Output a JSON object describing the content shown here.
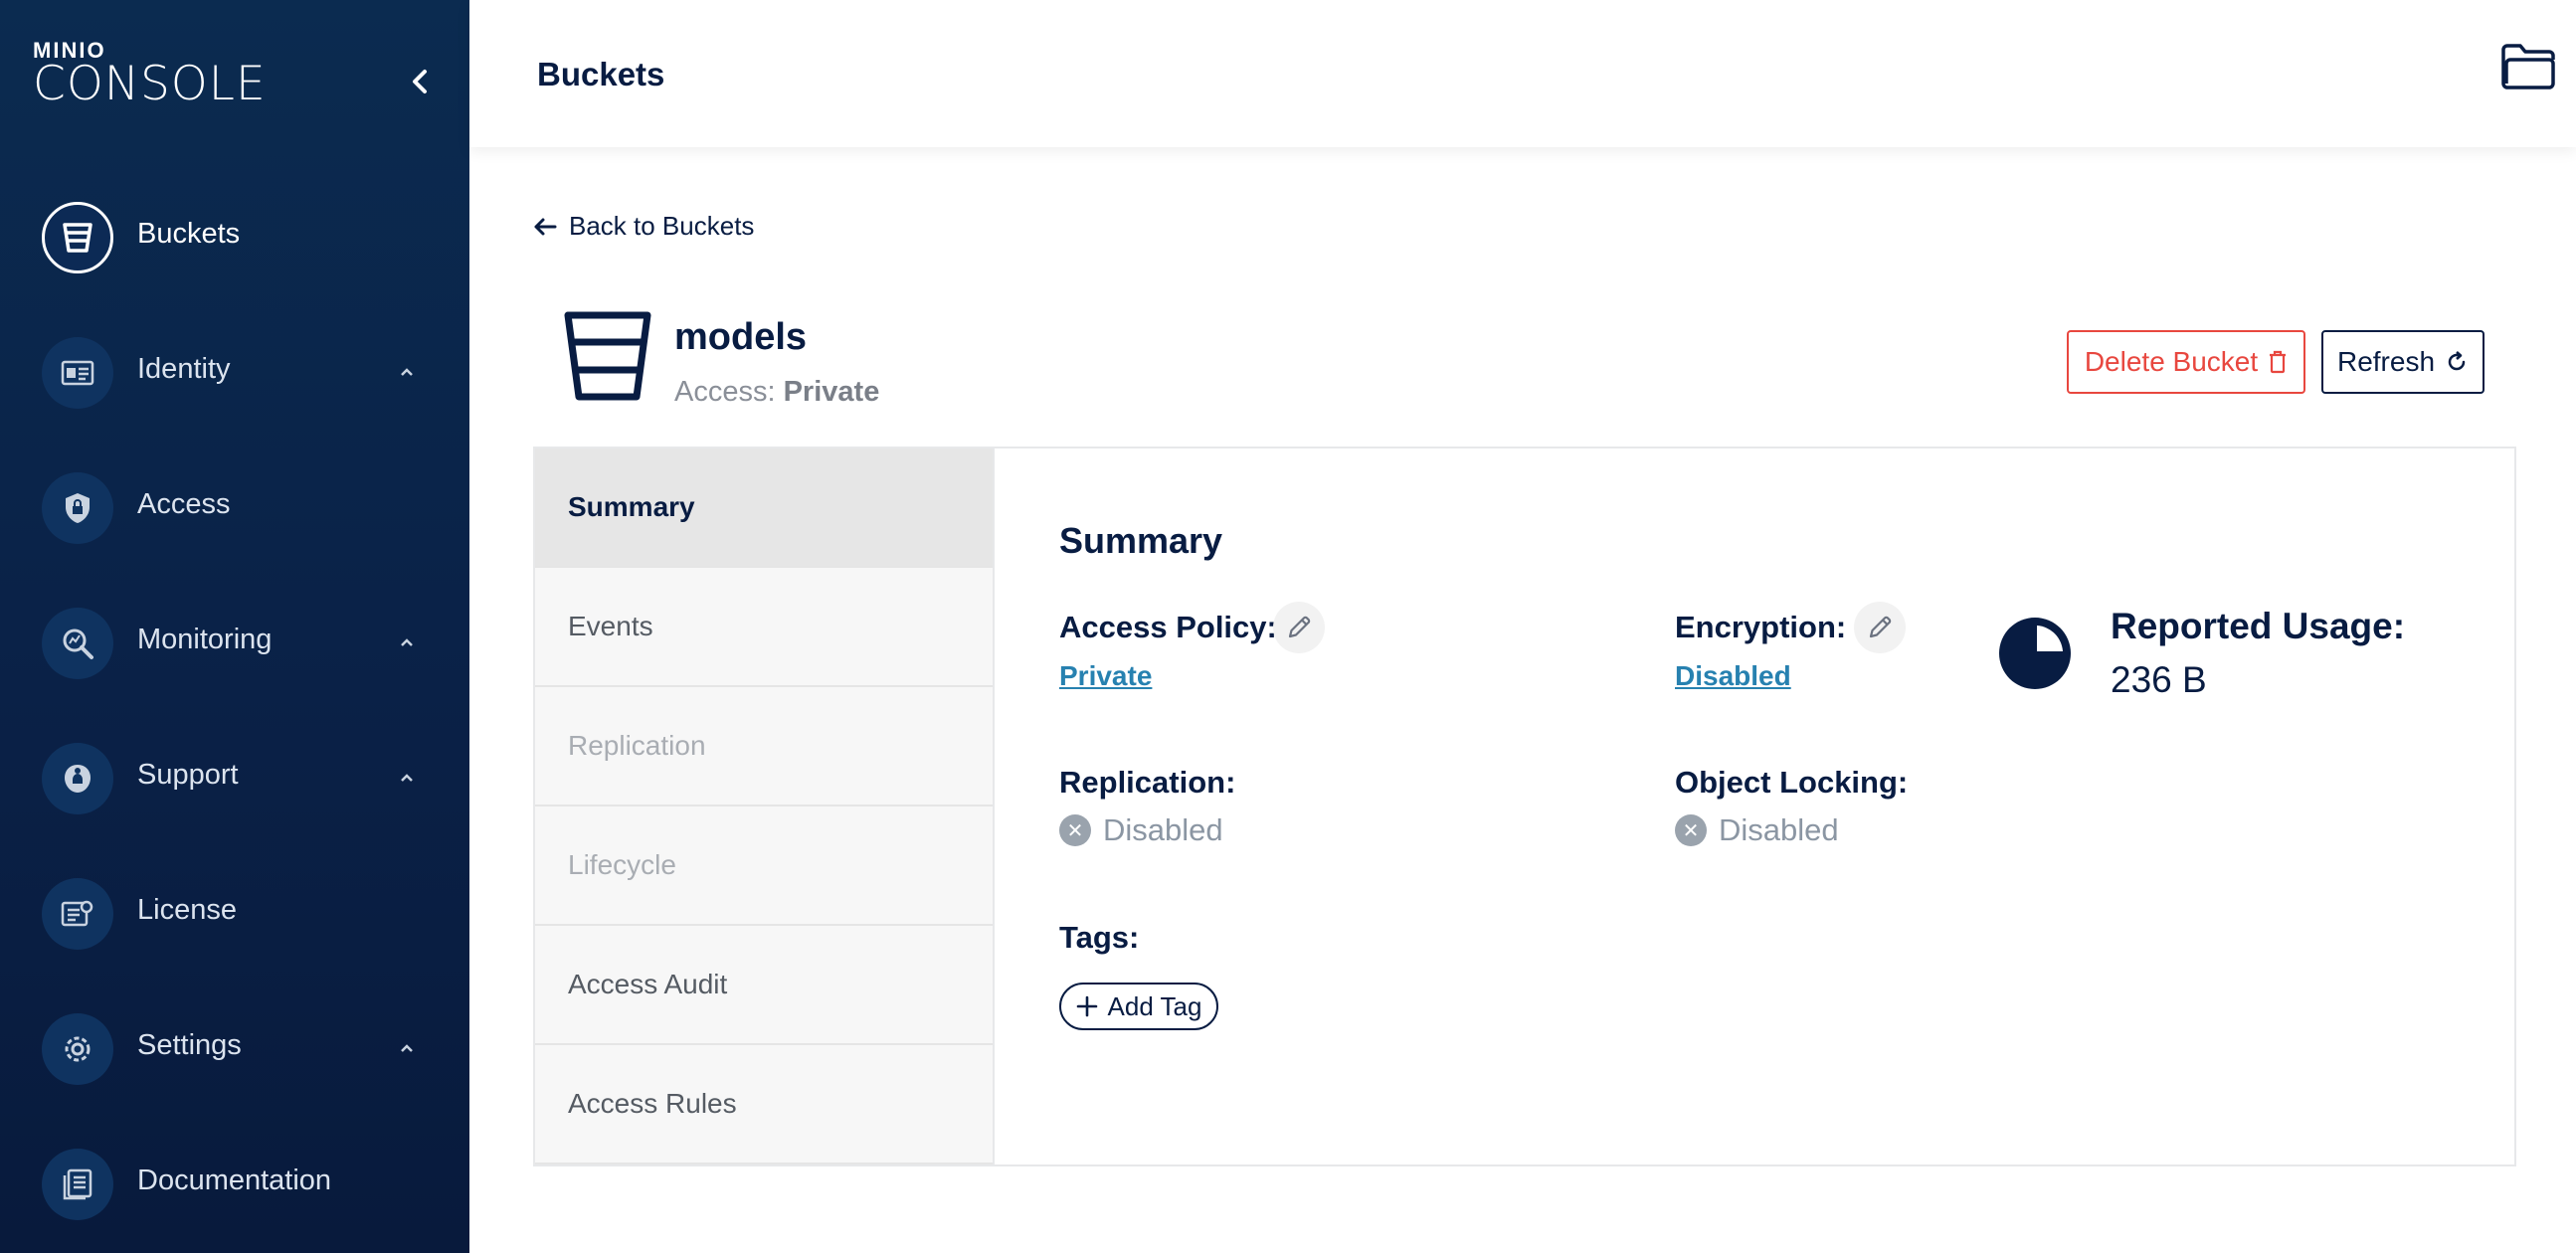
{
  "app": {
    "logo_top": "MINIO",
    "logo_bottom": "CONSOLE"
  },
  "sidebar": {
    "items": [
      {
        "label": "Buckets",
        "icon": "bucket-icon",
        "active": true
      },
      {
        "label": "Identity",
        "icon": "id-card-icon",
        "expandable": true
      },
      {
        "label": "Access",
        "icon": "shield-lock-icon"
      },
      {
        "label": "Monitoring",
        "icon": "magnifier-chart-icon",
        "expandable": true
      },
      {
        "label": "Support",
        "icon": "support-icon",
        "expandable": true
      },
      {
        "label": "License",
        "icon": "certificate-icon"
      },
      {
        "label": "Settings",
        "icon": "gear-icon",
        "expandable": true
      },
      {
        "label": "Documentation",
        "icon": "document-icon"
      }
    ]
  },
  "header": {
    "title": "Buckets"
  },
  "main": {
    "back_link": "Back to Buckets",
    "bucket_name": "models",
    "access_prefix": "Access:",
    "access_value": "Private",
    "delete_button": "Delete Bucket",
    "refresh_button": "Refresh",
    "tabs": [
      {
        "label": "Summary",
        "state": "active"
      },
      {
        "label": "Events",
        "state": "normal"
      },
      {
        "label": "Replication",
        "state": "disabled"
      },
      {
        "label": "Lifecycle",
        "state": "disabled"
      },
      {
        "label": "Access Audit",
        "state": "normal"
      },
      {
        "label": "Access Rules",
        "state": "normal"
      }
    ],
    "summary": {
      "title": "Summary",
      "access_policy_label": "Access Policy:",
      "access_policy_value": "Private",
      "encryption_label": "Encryption:",
      "encryption_value": "Disabled",
      "reported_usage_label": "Reported Usage:",
      "reported_usage_value": "236 B",
      "replication_label": "Replication:",
      "replication_value": "Disabled",
      "object_locking_label": "Object Locking:",
      "object_locking_value": "Disabled",
      "tags_label": "Tags:",
      "add_tag_button": "Add Tag"
    }
  },
  "colors": {
    "sidebar_bg": "#0a2147",
    "primary": "#081c42",
    "danger": "#e8473f",
    "link": "#2781b0",
    "muted": "#8b96a3"
  }
}
